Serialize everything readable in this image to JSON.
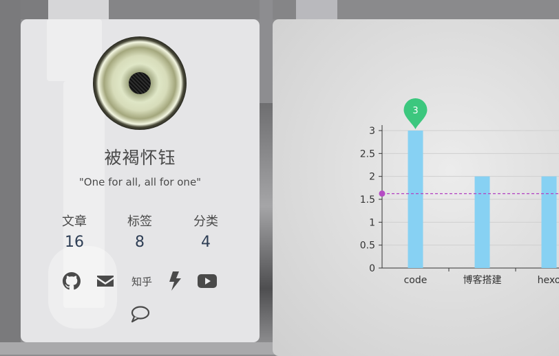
{
  "profile": {
    "name": "被褐怀钰",
    "motto": "\"One for all, all for one\"",
    "stats": [
      {
        "label": "文章",
        "value": "16"
      },
      {
        "label": "标签",
        "value": "8"
      },
      {
        "label": "分类",
        "value": "4"
      }
    ],
    "social": {
      "github": "github-icon",
      "email": "envelope-icon",
      "zhihu": "知乎",
      "bolt": "bolt-icon",
      "youtube": "youtube-icon",
      "comment": "comment-icon"
    }
  },
  "chart_data": {
    "type": "bar",
    "categories": [
      "code",
      "博客搭建",
      "hexo"
    ],
    "values": [
      3,
      2,
      2
    ],
    "ylim": [
      0,
      3
    ],
    "yticks": [
      "0",
      "0.5",
      "1",
      "1.5",
      "2",
      "2.5",
      "3"
    ],
    "average_line": 1.625,
    "max_marker_label": "3",
    "colors": {
      "bar": "#87d1f3",
      "marker": "#3cc77e",
      "average": "#b54bc4"
    }
  }
}
